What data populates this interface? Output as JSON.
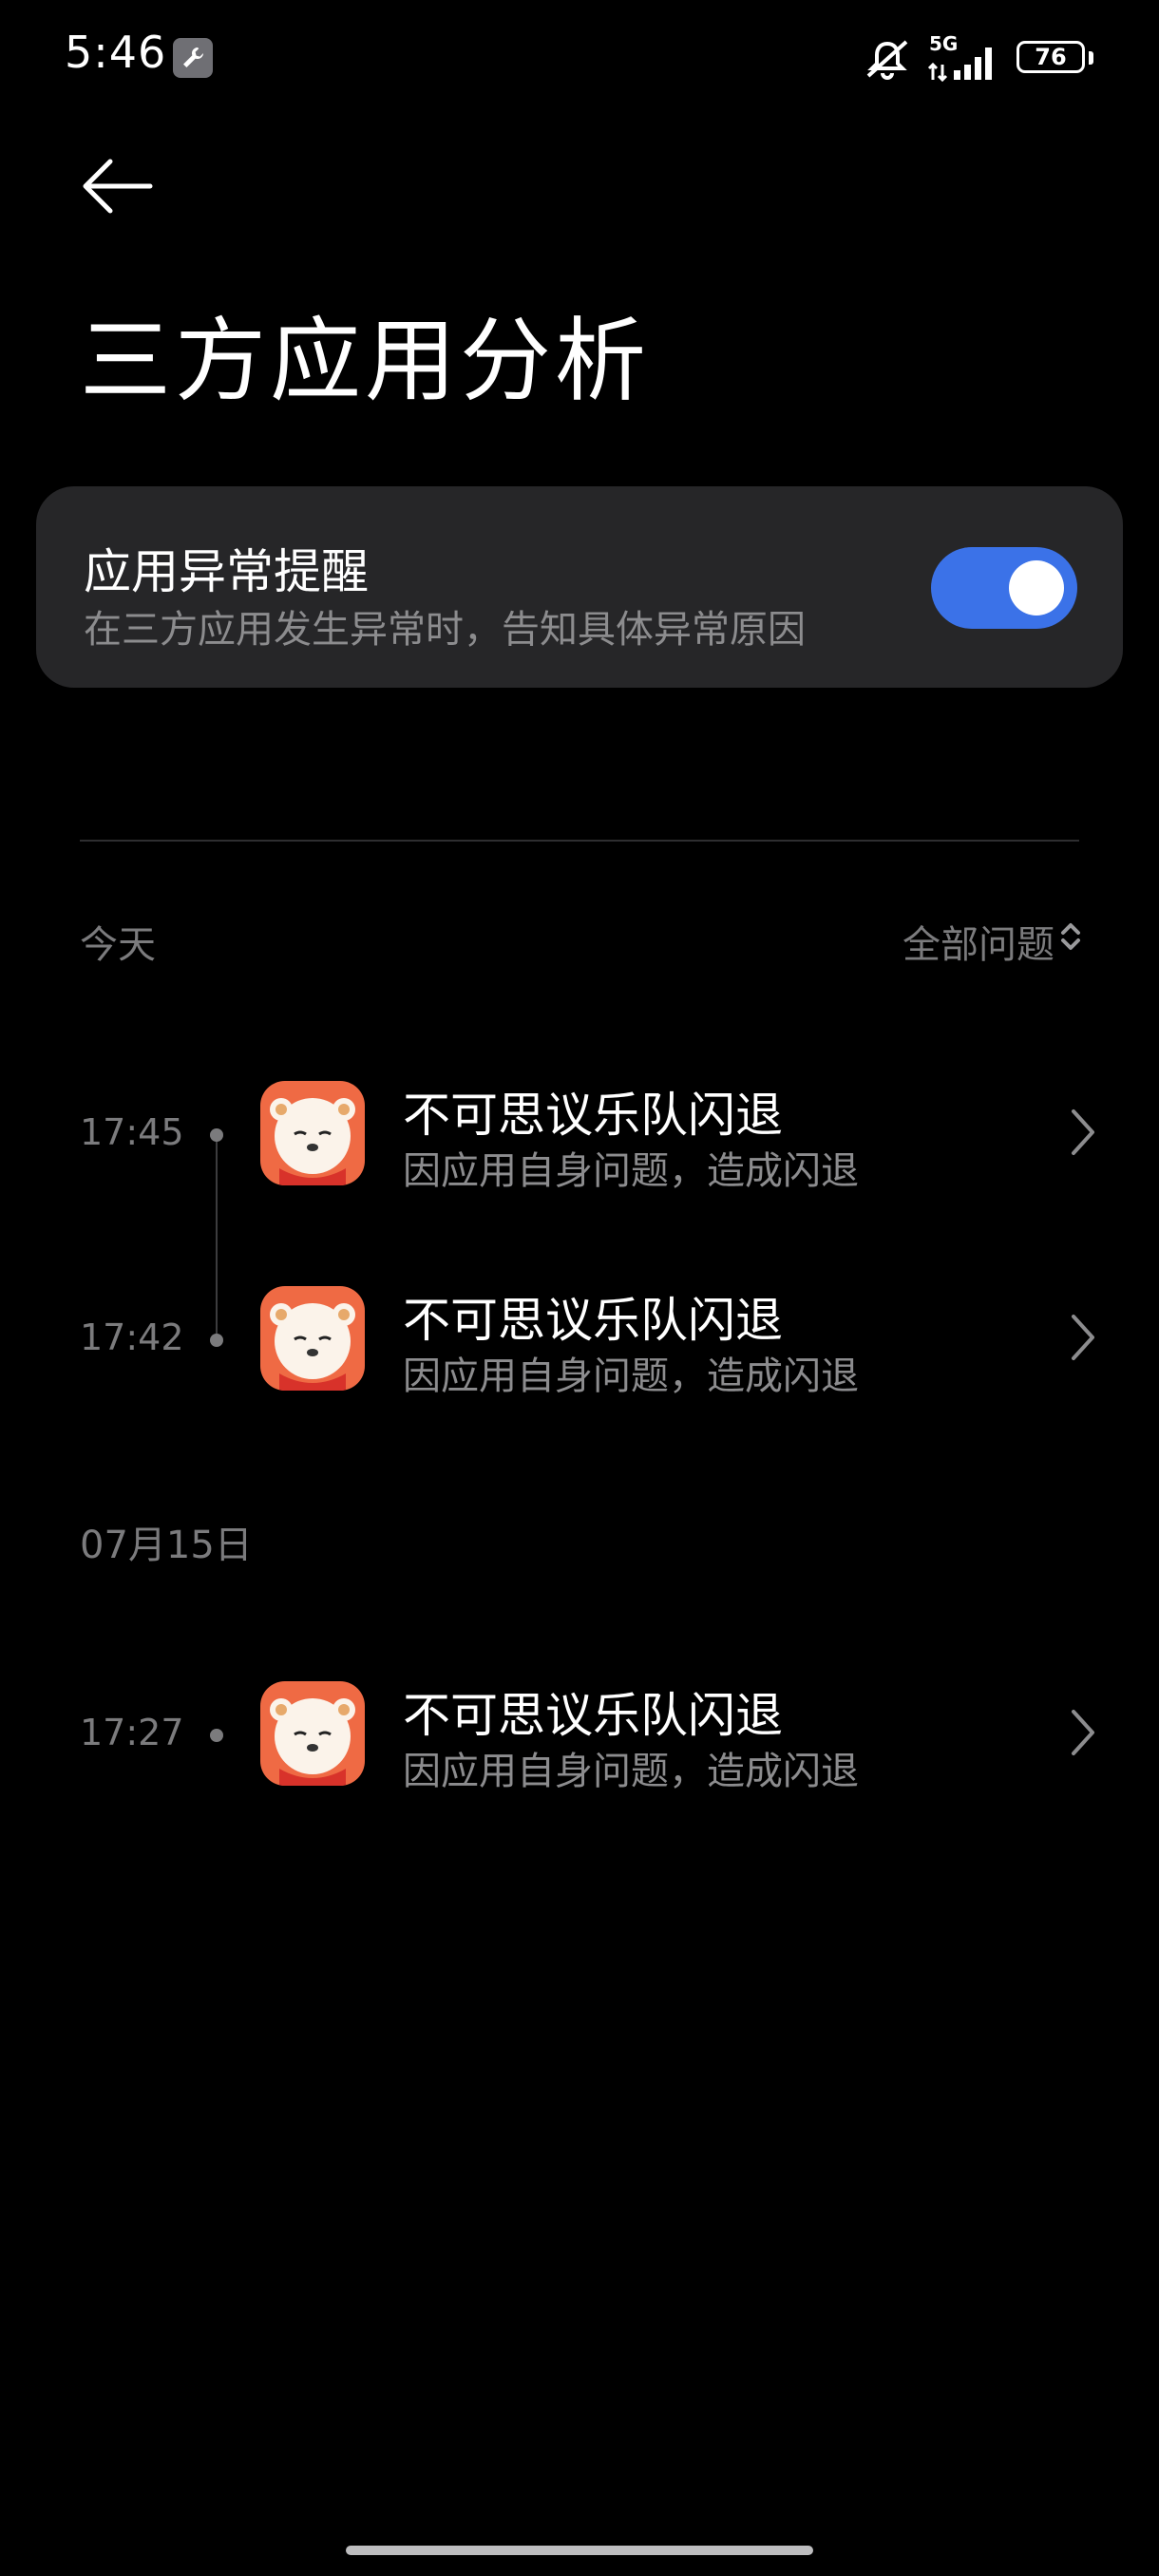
{
  "status_bar": {
    "time": "5:46",
    "network": "5G",
    "battery": "76",
    "icons": [
      "wrench-icon",
      "mute-icon",
      "signal-icon",
      "battery-icon"
    ]
  },
  "header": {
    "back_icon": "arrow-left-icon",
    "title": "三方应用分析"
  },
  "setting": {
    "title": "应用异常提醒",
    "subtitle": "在三方应用发生异常时，告知具体异常原因",
    "enabled": true,
    "accent_color": "#3b72e8"
  },
  "filter": {
    "label": "全部问题",
    "icon": "sort-updown-icon"
  },
  "sections": [
    {
      "label": "今天",
      "items": [
        {
          "time": "17:45",
          "app": "不可思议乐队闪退",
          "desc": "因应用自身问题，造成闪退"
        },
        {
          "time": "17:42",
          "app": "不可思议乐队闪退",
          "desc": "因应用自身问题，造成闪退"
        }
      ]
    },
    {
      "label": "07月15日",
      "items": [
        {
          "time": "17:27",
          "app": "不可思议乐队闪退",
          "desc": "因应用自身问题，造成闪退"
        }
      ]
    }
  ]
}
